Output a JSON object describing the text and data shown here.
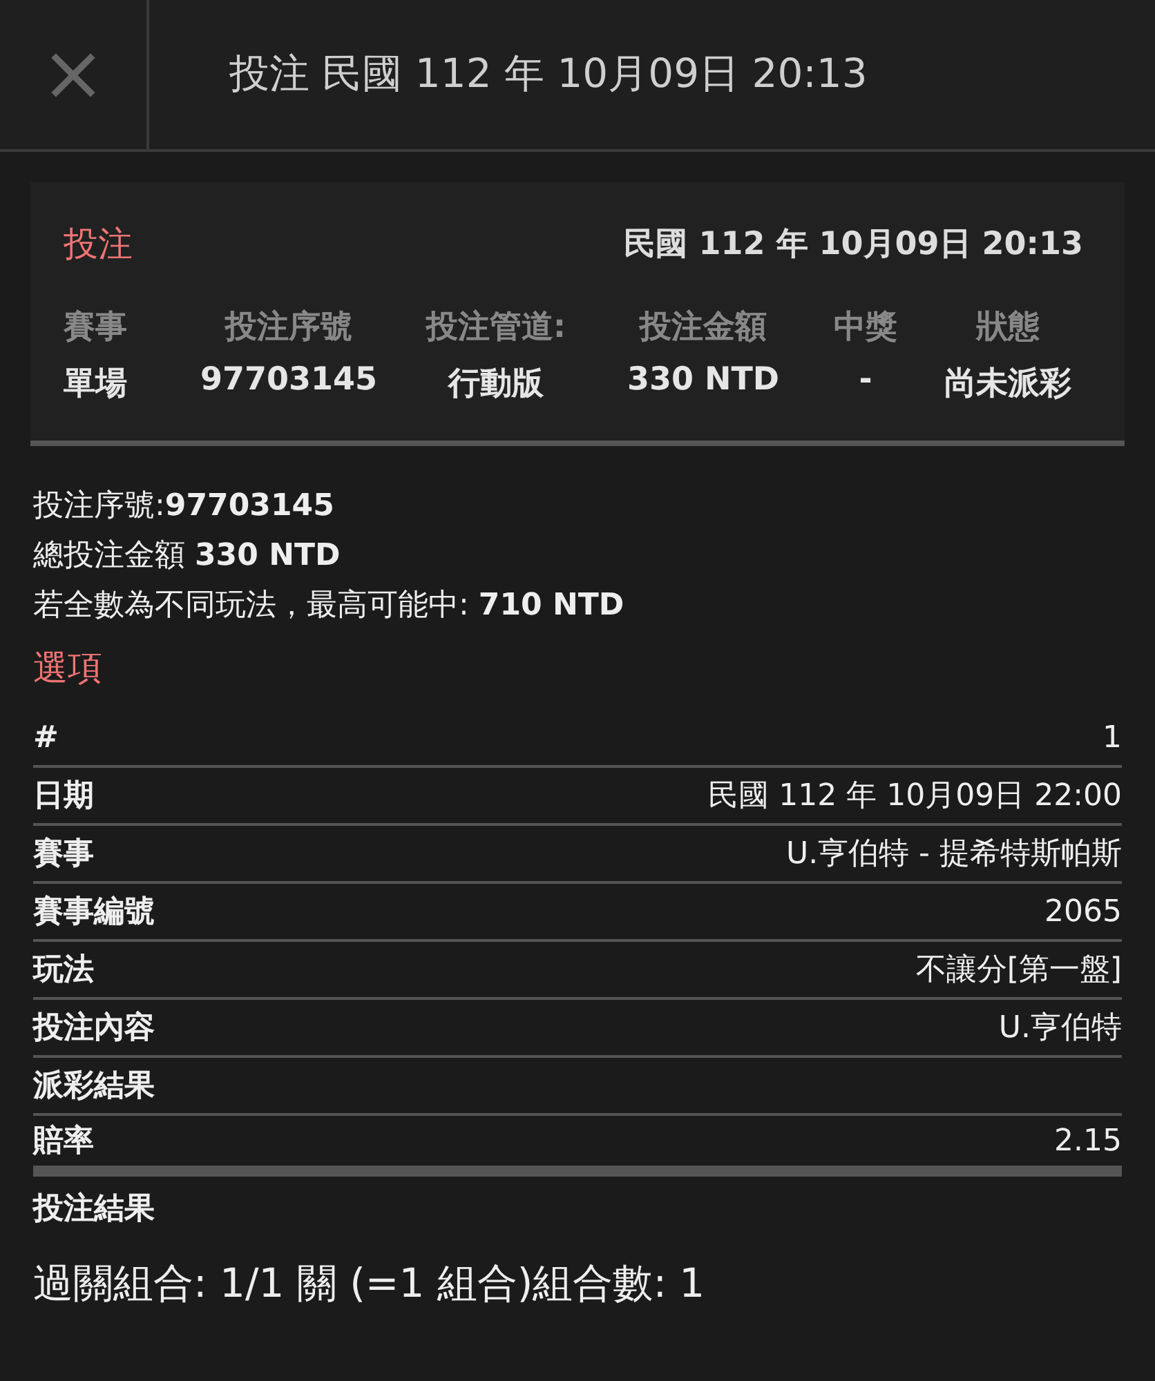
{
  "header": {
    "close": "×",
    "title": "投注 民國 112 年 10月09日 20:13"
  },
  "bet": {
    "label": "投注",
    "date": "民國 112 年 10月09日 20:13",
    "columns": [
      "賽事",
      "投注序號",
      "投注管道:",
      "投注金額",
      "中獎",
      "狀態"
    ],
    "values": [
      "單場",
      "97703145",
      "行動版",
      "330 NTD",
      "-",
      "尚未派彩"
    ]
  },
  "summary": [
    "投注序號:**97703145**",
    "總投注金額 **330 NTD**",
    "若全數為不同玩法，最高可能中: **710 NTD**"
  ],
  "options": {
    "label": "選項",
    "rows": [
      {
        "label": "#",
        "value": "1"
      },
      {
        "label": "日期",
        "value": "民國 112 年 10月09日 22:00"
      },
      {
        "label": "賽事",
        "value": "U.亨伯特 - 提希特斯帕斯"
      },
      {
        "label": "賽事編號",
        "value": "2065"
      },
      {
        "label": "玩法",
        "value": "不讓分[第一盤]"
      },
      {
        "label": "投注內容",
        "value": "U.亨伯特"
      },
      {
        "label": "派彩結果",
        "value": ""
      },
      {
        "label": "賠率",
        "value": "2.15"
      }
    ],
    "result_label": "投注結果"
  },
  "combo": "過關組合: 1/1 關 (=1 組合)組合數: 1"
}
